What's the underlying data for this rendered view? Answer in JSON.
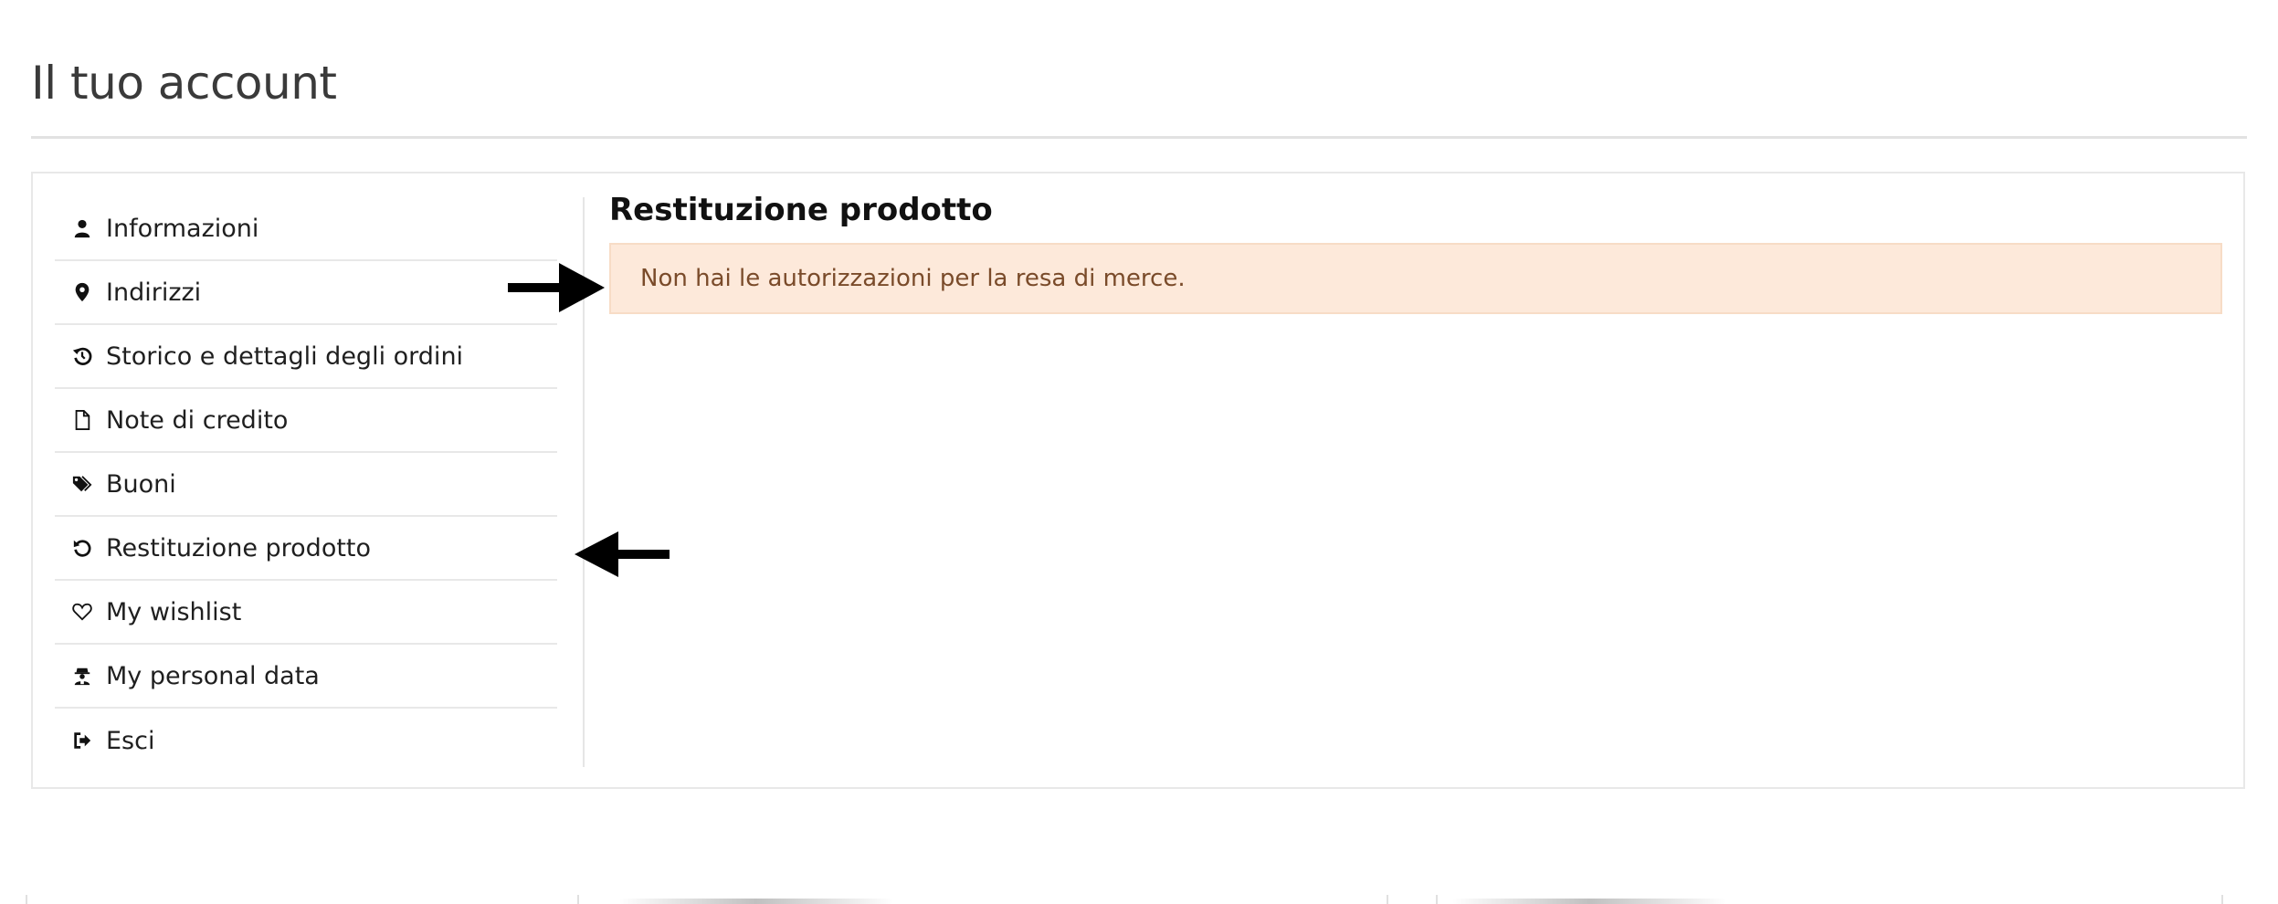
{
  "page": {
    "title": "Il tuo account"
  },
  "sidebar": {
    "items": [
      {
        "label": "Informazioni",
        "icon": "user-icon"
      },
      {
        "label": "Indirizzi",
        "icon": "map-marker-icon"
      },
      {
        "label": "Storico e dettagli degli ordini",
        "icon": "history-icon"
      },
      {
        "label": "Note di credito",
        "icon": "file-icon"
      },
      {
        "label": "Buoni",
        "icon": "tags-icon"
      },
      {
        "label": "Restituzione prodotto",
        "icon": "undo-icon"
      },
      {
        "label": "My wishlist",
        "icon": "heart-icon"
      },
      {
        "label": "My personal data",
        "icon": "user-secret-icon"
      },
      {
        "label": "Esci",
        "icon": "sign-out-icon"
      }
    ]
  },
  "main": {
    "section_title": "Restituzione prodotto",
    "alert": {
      "text": "Non hai le autorizzazioni per la resa di merce.",
      "background": "#fde9da",
      "text_color": "#7a4b2a"
    }
  },
  "colors": {
    "title": "#3a3a3a",
    "border": "#e8e8e8",
    "annotation_arrow": "#000000"
  }
}
